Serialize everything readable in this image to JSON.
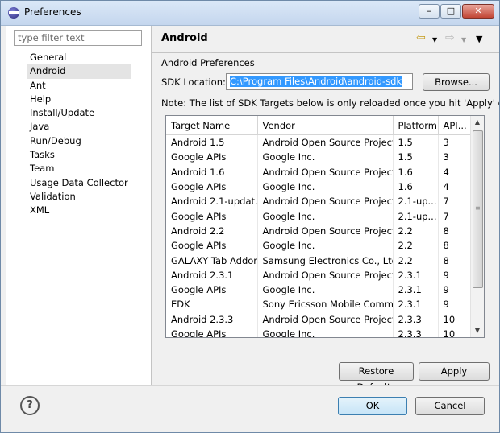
{
  "window": {
    "title": "Preferences",
    "controls": {
      "minimize": "–",
      "maximize": "□",
      "close": "✕"
    }
  },
  "left": {
    "filter_placeholder": "type filter text",
    "items": [
      "General",
      "Android",
      "Ant",
      "Help",
      "Install/Update",
      "Java",
      "Run/Debug",
      "Tasks",
      "Team",
      "Usage Data Collector",
      "Validation",
      "XML"
    ],
    "selected": "Android"
  },
  "page": {
    "title": "Android",
    "section": "Android Preferences",
    "sdk_label": "SDK Location:",
    "sdk_path": "C:\\Program Files\\Android\\android-sdk",
    "browse": "Browse...",
    "note": "Note: The list of SDK Targets below is only reloaded once you hit 'Apply' or 'OK'.",
    "nav": {
      "back": "⇦",
      "back_menu": "▼",
      "forward": "⇨",
      "forward_menu": "▼",
      "view_menu": "▼"
    },
    "restore": "Restore Defaults",
    "apply": "Apply"
  },
  "table": {
    "columns": [
      "Target Name",
      "Vendor",
      "Platform",
      "API..."
    ],
    "rows": [
      [
        "Android 1.5",
        "Android Open Source Project",
        "1.5",
        "3"
      ],
      [
        "Google APIs",
        "Google Inc.",
        "1.5",
        "3"
      ],
      [
        "Android 1.6",
        "Android Open Source Project",
        "1.6",
        "4"
      ],
      [
        "Google APIs",
        "Google Inc.",
        "1.6",
        "4"
      ],
      [
        "Android 2.1-updat...",
        "Android Open Source Project",
        "2.1-up...",
        "7"
      ],
      [
        "Google APIs",
        "Google Inc.",
        "2.1-up...",
        "7"
      ],
      [
        "Android 2.2",
        "Android Open Source Project",
        "2.2",
        "8"
      ],
      [
        "Google APIs",
        "Google Inc.",
        "2.2",
        "8"
      ],
      [
        "GALAXY Tab Addon",
        "Samsung Electronics Co., Ltd.",
        "2.2",
        "8"
      ],
      [
        "Android 2.3.1",
        "Android Open Source Project",
        "2.3.1",
        "9"
      ],
      [
        "Google APIs",
        "Google Inc.",
        "2.3.1",
        "9"
      ],
      [
        "EDK",
        "Sony Ericsson Mobile Comm...",
        "2.3.1",
        "9"
      ],
      [
        "Android 2.3.3",
        "Android Open Source Project",
        "2.3.3",
        "10"
      ],
      [
        "Google APIs",
        "Google Inc.",
        "2.3.3",
        "10"
      ]
    ],
    "scroll": {
      "up": "▲",
      "down": "▼",
      "grip": "≡"
    }
  },
  "footer": {
    "help": "?",
    "ok": "OK",
    "cancel": "Cancel"
  }
}
